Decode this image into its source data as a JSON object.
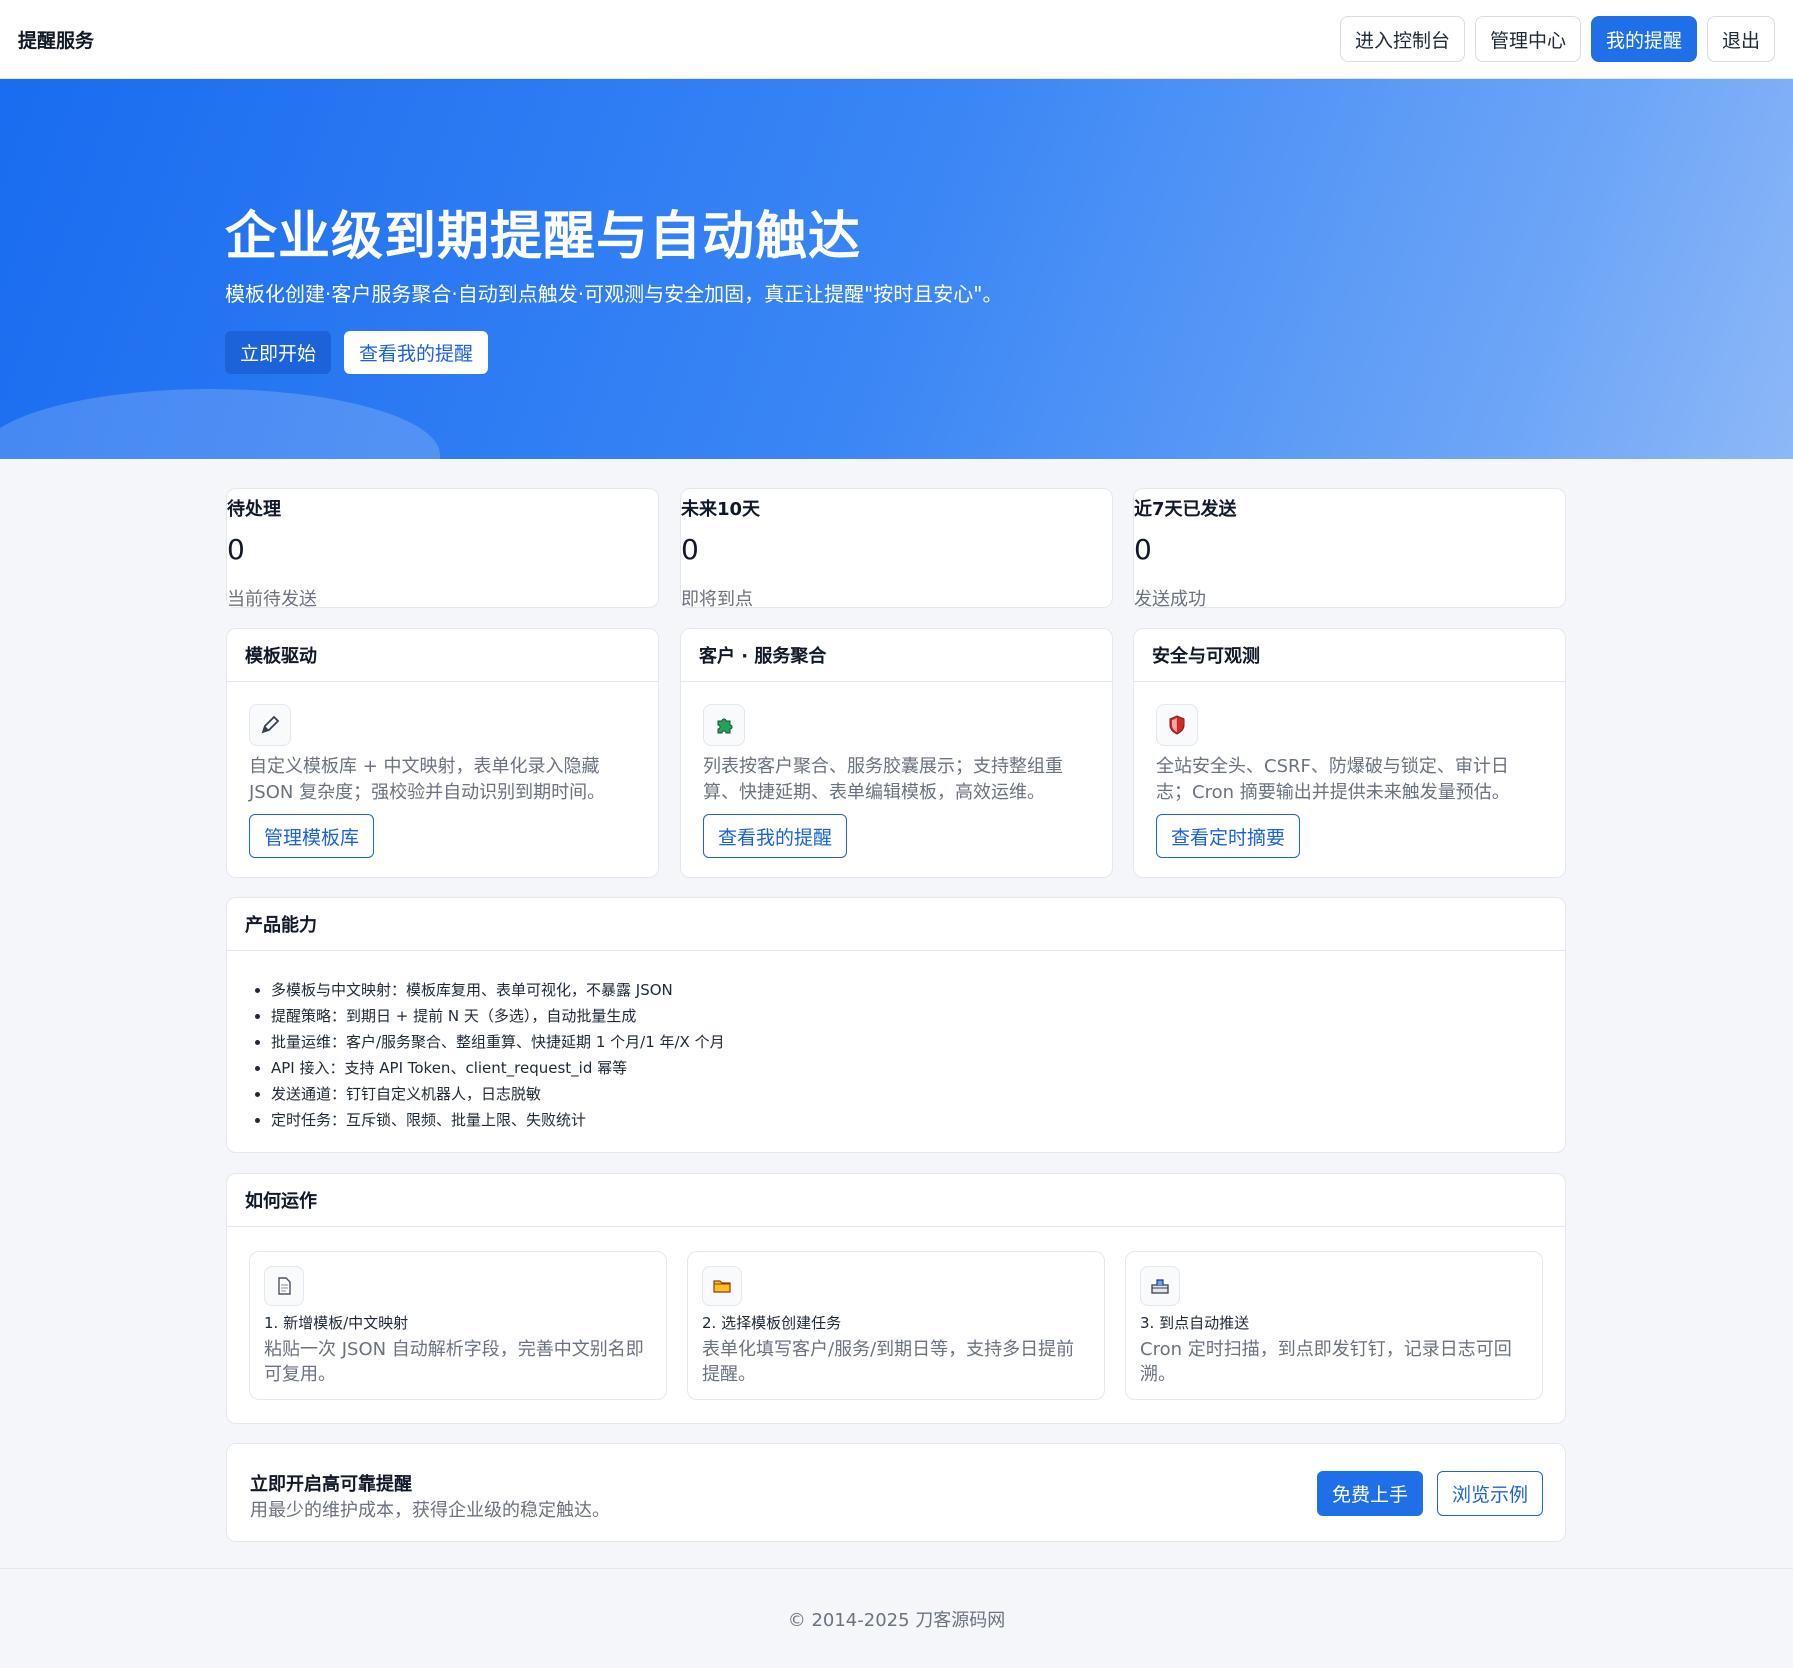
{
  "navbar": {
    "brand": "提醒服务",
    "buttons": [
      "进入控制台",
      "管理中心",
      "我的提醒",
      "退出"
    ]
  },
  "hero": {
    "title": "企业级到期提醒与自动触达",
    "subtitle": "模板化创建·客户服务聚合·自动到点触发·可观测与安全加固，真正让提醒\"按时且安心\"。",
    "primary_button": "立即开始",
    "secondary_button": "查看我的提醒"
  },
  "stats": [
    {
      "title": "待处理",
      "value": "0",
      "desc": "当前待发送"
    },
    {
      "title": "未来10天",
      "value": "0",
      "desc": "即将到点"
    },
    {
      "title": "近7天已发送",
      "value": "0",
      "desc": "发送成功"
    }
  ],
  "features": [
    {
      "title": "模板驱动",
      "icon": "pencil-icon",
      "text": "自定义模板库 + 中文映射，表单化录入隐藏 JSON 复杂度；强校验并自动识别到期时间。",
      "button": "管理模板库"
    },
    {
      "title": "客户 · 服务聚合",
      "icon": "puzzle-icon",
      "text": "列表按客户聚合、服务胶囊展示；支持整组重算、快捷延期、表单编辑模板，高效运维。",
      "button": "查看我的提醒"
    },
    {
      "title": "安全与可观测",
      "icon": "shield-icon",
      "text": "全站安全头、CSRF、防爆破与锁定、审计日志；Cron 摘要输出并提供未来触发量预估。",
      "button": "查看定时摘要"
    }
  ],
  "capabilities": {
    "title": "产品能力",
    "items": [
      "多模板与中文映射：模板库复用、表单可视化，不暴露 JSON",
      "提醒策略：到期日 + 提前 N 天（多选），自动批量生成",
      "批量运维：客户/服务聚合、整组重算、快捷延期 1 个月/1 年/X 个月",
      "API 接入：支持 API Token、client_request_id 幂等",
      "发送通道：钉钉自定义机器人，日志脱敏",
      "定时任务：互斥锁、限频、批量上限、失败统计"
    ]
  },
  "how": {
    "title": "如何运作",
    "steps": [
      {
        "icon": "document-icon",
        "title": "1. 新增模板/中文映射",
        "desc": "粘贴一次 JSON 自动解析字段，完善中文别名即可复用。"
      },
      {
        "icon": "folder-icon",
        "title": "2. 选择模板创建任务",
        "desc": "表单化填写客户/服务/到期日等，支持多日提前提醒。"
      },
      {
        "icon": "inbox-icon",
        "title": "3. 到点自动推送",
        "desc": "Cron 定时扫描，到点即发钉钉，记录日志可回溯。"
      }
    ]
  },
  "cta": {
    "title": "立即开启高可靠提醒",
    "subtitle": "用最少的维护成本，获得企业级的稳定触达。",
    "primary_button": "免费上手",
    "secondary_button": "浏览示例"
  },
  "footer": {
    "text": "© 2014-2025 刀客源码网"
  },
  "colors": {
    "accent": "#1f6fe8",
    "hero_start": "#1a6cf0",
    "hero_end": "#8db8f7"
  }
}
